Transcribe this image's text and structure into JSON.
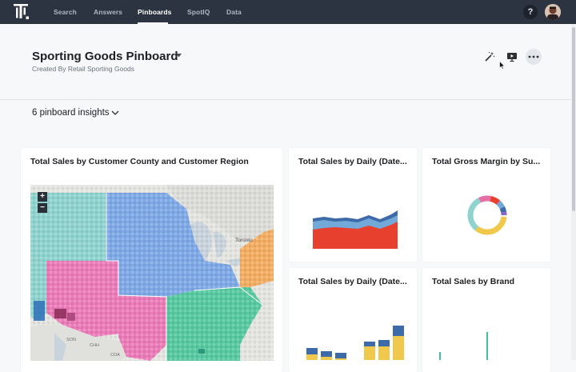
{
  "nav": {
    "items": [
      {
        "label": "Search",
        "active": false
      },
      {
        "label": "Answers",
        "active": false
      },
      {
        "label": "Pinboards",
        "active": true
      },
      {
        "label": "SpotIQ",
        "active": false
      },
      {
        "label": "Data",
        "active": false
      }
    ],
    "help_label": "?"
  },
  "header": {
    "title": "Sporting Goods Pinboard",
    "subtitle": "Created By Retail Sporting Goods",
    "actions": [
      "magic-wand-icon",
      "present-icon",
      "more-icon"
    ]
  },
  "insights_label": "6 pinboard insights",
  "cards": {
    "map": {
      "title": "Total Sales by Customer County and Customer Region",
      "zoom_in": "+",
      "zoom_out": "−",
      "labels": {
        "toronto": "Toronto",
        "son": "SON",
        "chh": "CHH",
        "coa": "COA"
      }
    },
    "daily1": {
      "title": "Total Sales by Daily (Date..."
    },
    "margin": {
      "title": "Total Gross Margin by Su..."
    },
    "daily2": {
      "title": "Total Sales by Daily (Date..."
    },
    "brand": {
      "title": "Total Sales by Brand"
    }
  },
  "colors": {
    "nav_bg": "#2c3341",
    "red": "#e8402f",
    "blue": "#3d6aa8",
    "light_blue": "#72a9d9",
    "yellow": "#f0c84b",
    "teal": "#3fbf9c",
    "pink": "#e66fa6",
    "purple": "#8a63c4"
  }
}
